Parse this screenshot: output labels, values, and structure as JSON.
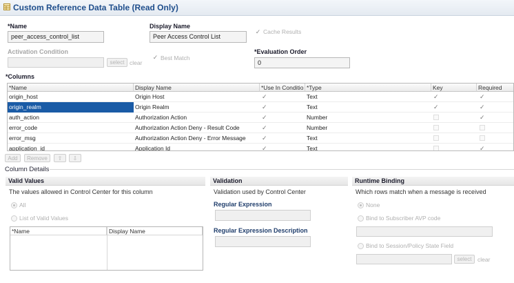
{
  "window": {
    "title": "Custom Reference Data Table (Read Only)"
  },
  "form": {
    "name_label": "*Name",
    "name_value": "peer_access_control_list",
    "display_name_label": "Display Name",
    "display_name_value": "Peer Access Control List",
    "cache_results_label": "Cache Results",
    "activation_condition_label": "Activation Condition",
    "select_label": "select",
    "clear_label": "clear",
    "best_match_label": "Best Match",
    "evaluation_order_label": "*Evaluation Order",
    "evaluation_order_value": "0"
  },
  "columns": {
    "label": "*Columns",
    "headers": [
      "*Name",
      "Display Name",
      "*Use In Conditio",
      "*Type",
      "Key",
      "Required"
    ],
    "rows": [
      {
        "name": "origin_host",
        "display": "Origin Host",
        "use": true,
        "type": "Text",
        "key": true,
        "required": true
      },
      {
        "name": "origin_realm",
        "display": "Origin Realm",
        "use": true,
        "type": "Text",
        "key": true,
        "required": true
      },
      {
        "name": "auth_action",
        "display": "Authorization Action",
        "use": true,
        "type": "Number",
        "key": false,
        "required": true
      },
      {
        "name": "error_code",
        "display": "Authorization Action Deny - Result Code",
        "use": true,
        "type": "Number",
        "key": false,
        "required": false
      },
      {
        "name": "error_msg",
        "display": "Authorization Action Deny - Error Message",
        "use": true,
        "type": "Text",
        "key": false,
        "required": false
      },
      {
        "name": "application_id",
        "display": "Application Id",
        "use": true,
        "type": "Text",
        "key": false,
        "required": true
      }
    ],
    "selected_row": 1,
    "add_label": "Add",
    "remove_label": "Remove"
  },
  "column_details": {
    "label": "Column Details",
    "valid_values": {
      "header": "Valid Values",
      "desc": "The values allowed in Control Center for this column",
      "opt_all": "All",
      "opt_list": "List of Valid Values",
      "table_headers": [
        "*Name",
        "Display Name"
      ]
    },
    "validation": {
      "header": "Validation",
      "desc": "Validation used by Control Center",
      "regex_label": "Regular Expression",
      "regex_desc_label": "Regular Expression Description"
    },
    "runtime": {
      "header": "Runtime Binding",
      "desc": "Which rows match when a message is received",
      "opt_none": "None",
      "opt_avp": "Bind to Subscriber AVP code",
      "opt_session": "Bind to Session/Policy State Field",
      "select_label": "select",
      "clear_label": "clear"
    }
  }
}
